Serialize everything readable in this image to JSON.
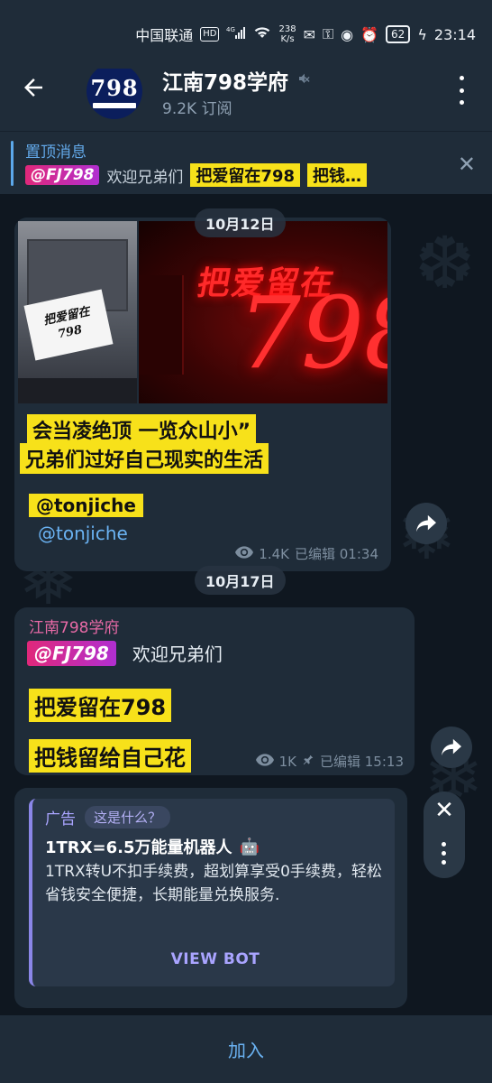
{
  "status_bar": {
    "carrier": "中国联通",
    "hd": "HD",
    "net_type": "4G",
    "speed_value": "238",
    "speed_unit": "K/s",
    "battery": "62",
    "time": "23:14"
  },
  "header": {
    "avatar_text": "798",
    "title": "江南798学府",
    "subscribers": "9.2K 订阅"
  },
  "pinned": {
    "title": "置顶消息",
    "tag": "@FJ798",
    "text": "欢迎兄弟们",
    "highlight1": "把爱留在798",
    "highlight2": "把钱…"
  },
  "dates": {
    "first": "10月12日",
    "second": "10月17日"
  },
  "message1": {
    "photo_flag_line1": "把爱留在",
    "photo_flag_line2": "798",
    "photo_sign_top": "把爱留在",
    "photo_sign_num": "798",
    "line1": "会当凌绝顶 一览众山小”",
    "line2": "兄弟们过好自己现实的生活",
    "mention_highlight": "@tonjiche",
    "mention_link": "@tonjiche",
    "views": "1.4K",
    "edited_time": "已编辑 01:34"
  },
  "message2": {
    "author": "江南798学府",
    "tag": "@FJ798",
    "text": "欢迎兄弟们",
    "highlight1": "把爱留在798",
    "highlight2": "把钱留给自己花",
    "views": "1K",
    "edited_time": "已编辑 15:13"
  },
  "ad": {
    "label": "广告",
    "what": "这是什么？",
    "title": "1TRX=6.5万能量机器人",
    "title_emoji": "🤖",
    "body": "1TRX转U不扣手续费，超划算享受0手续费，轻松省钱安全便捷，长期能量兑换服务.",
    "button": "VIEW BOT"
  },
  "footer": {
    "join_label": "加入"
  },
  "colors": {
    "accent": "#6ab2f2",
    "highlight": "#f7e11a",
    "ad_accent": "#a9a4ff"
  }
}
